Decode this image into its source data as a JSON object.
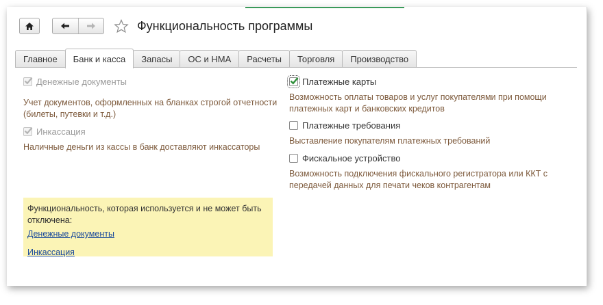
{
  "window": {
    "title": "Функциональность программы"
  },
  "toolbar": {
    "home_icon": "home-icon",
    "back_icon": "arrow-left-icon",
    "forward_icon": "arrow-right-icon",
    "favorite_icon": "star-icon"
  },
  "tabs": [
    {
      "label": "Главное",
      "active": false
    },
    {
      "label": "Банк и касса",
      "active": true
    },
    {
      "label": "Запасы",
      "active": false
    },
    {
      "label": "ОС и НМА",
      "active": false
    },
    {
      "label": "Расчеты",
      "active": false
    },
    {
      "label": "Торговля",
      "active": false
    },
    {
      "label": "Производство",
      "active": false
    }
  ],
  "left_options": [
    {
      "label": "Денежные документы",
      "checked": true,
      "disabled": true,
      "description": "Учет документов, оформленных на бланках строгой отчетности (билеты, путевки и т.д.)"
    },
    {
      "label": "Инкассация",
      "checked": true,
      "disabled": true,
      "description": "Наличные деньги из кассы в банк доставляют инкассаторы"
    }
  ],
  "right_options": [
    {
      "label": "Платежные карты",
      "checked": true,
      "disabled": false,
      "description": "Возможность оплаты товаров и услуг покупателями при помощи платежных карт и банковских кредитов"
    },
    {
      "label": "Платежные требования",
      "checked": false,
      "disabled": false,
      "description": "Выставление покупателям платежных требований"
    },
    {
      "label": "Фискальное устройство",
      "checked": false,
      "disabled": false,
      "description": "Возможность подключения фискального регистратора или ККТ с передачей данных для печати чеков контрагентам"
    }
  ],
  "note": {
    "text": "Функциональность, которая используется и не может быть отключена:",
    "links": [
      "Денежные документы",
      "Инкассация"
    ]
  },
  "colors": {
    "accent_line": "#3a9a5a",
    "check_green": "#2f8f3a",
    "description_text": "#7d5a3c",
    "note_background": "#fbf4b6",
    "link": "#1a4a9c"
  }
}
